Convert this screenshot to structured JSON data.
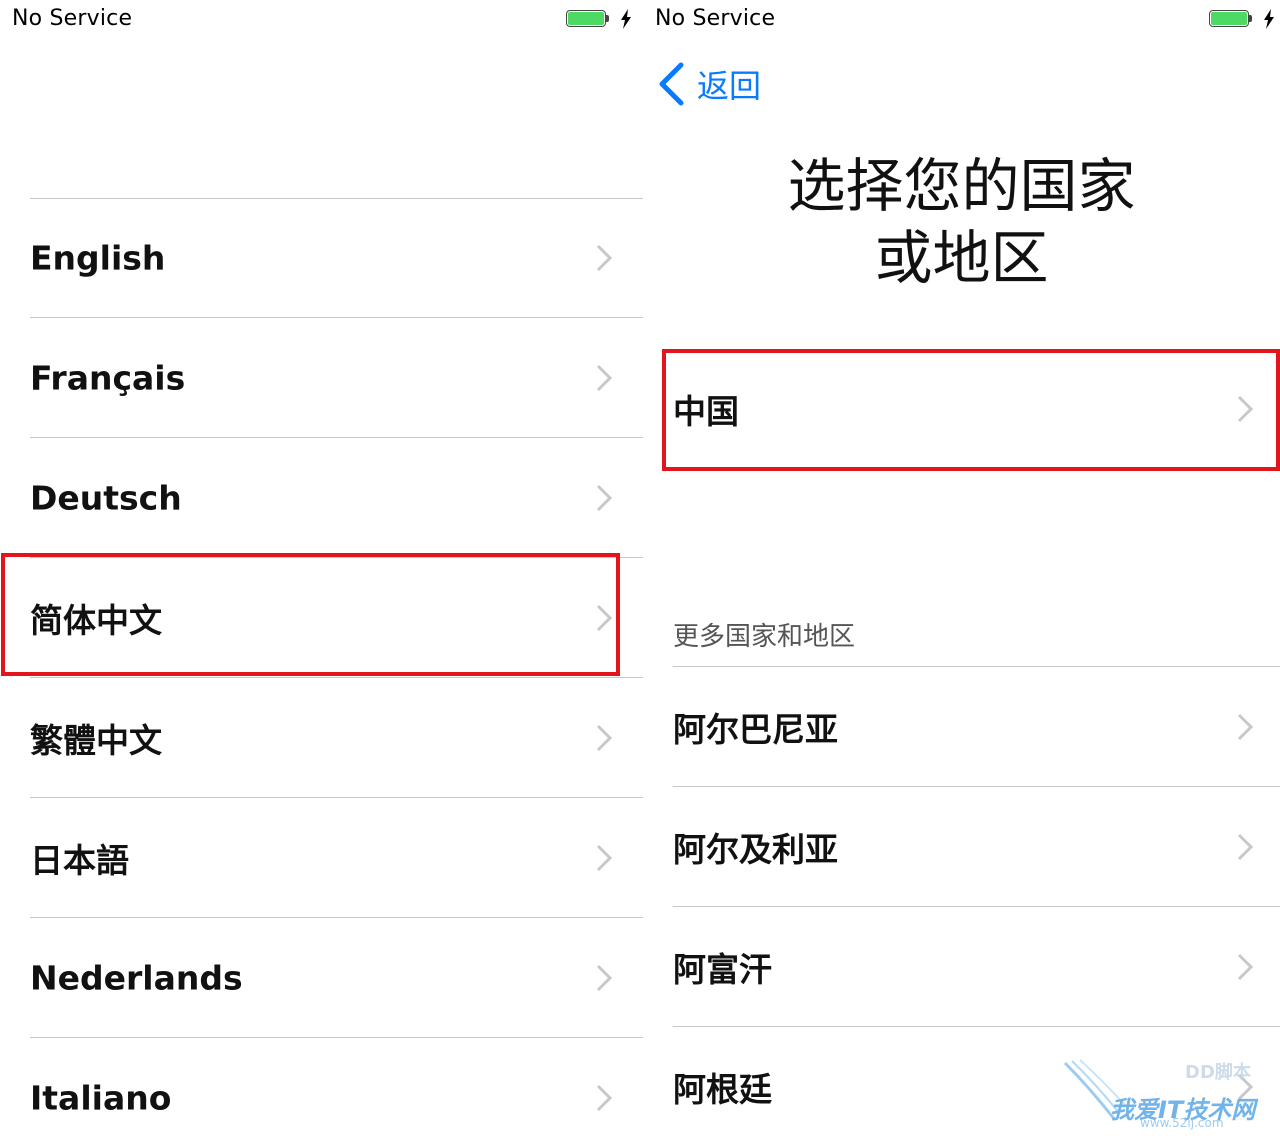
{
  "left": {
    "status": {
      "carrier": "No Service"
    },
    "languages": [
      {
        "label": "English"
      },
      {
        "label": "Français"
      },
      {
        "label": "Deutsch"
      },
      {
        "label": "简体中文",
        "highlighted": true
      },
      {
        "label": "繁體中文"
      },
      {
        "label": "日本語"
      },
      {
        "label": "Nederlands"
      },
      {
        "label": "Italiano"
      }
    ]
  },
  "right": {
    "status": {
      "carrier": "No Service"
    },
    "back_label": "返回",
    "title_line1": "选择您的国家",
    "title_line2": "或地区",
    "suggested": {
      "label": "中国",
      "highlighted": true
    },
    "section_header": "更多国家和地区",
    "countries": [
      {
        "label": "阿尔巴尼亚"
      },
      {
        "label": "阿尔及利亚"
      },
      {
        "label": "阿富汗"
      },
      {
        "label": "阿根廷"
      }
    ]
  },
  "watermark": {
    "text": "我爱IT技术网",
    "url": "www.52ij.com",
    "corner": "DD脚本"
  },
  "colors": {
    "accent": "#0a7aff",
    "highlight": "#e3141b",
    "battery": "#4cd964",
    "divider": "#c8c7cc"
  },
  "icons": {
    "chevron": "chevron-right-icon",
    "back": "chevron-left-icon",
    "battery": "battery-icon",
    "charging": "bolt-icon"
  }
}
